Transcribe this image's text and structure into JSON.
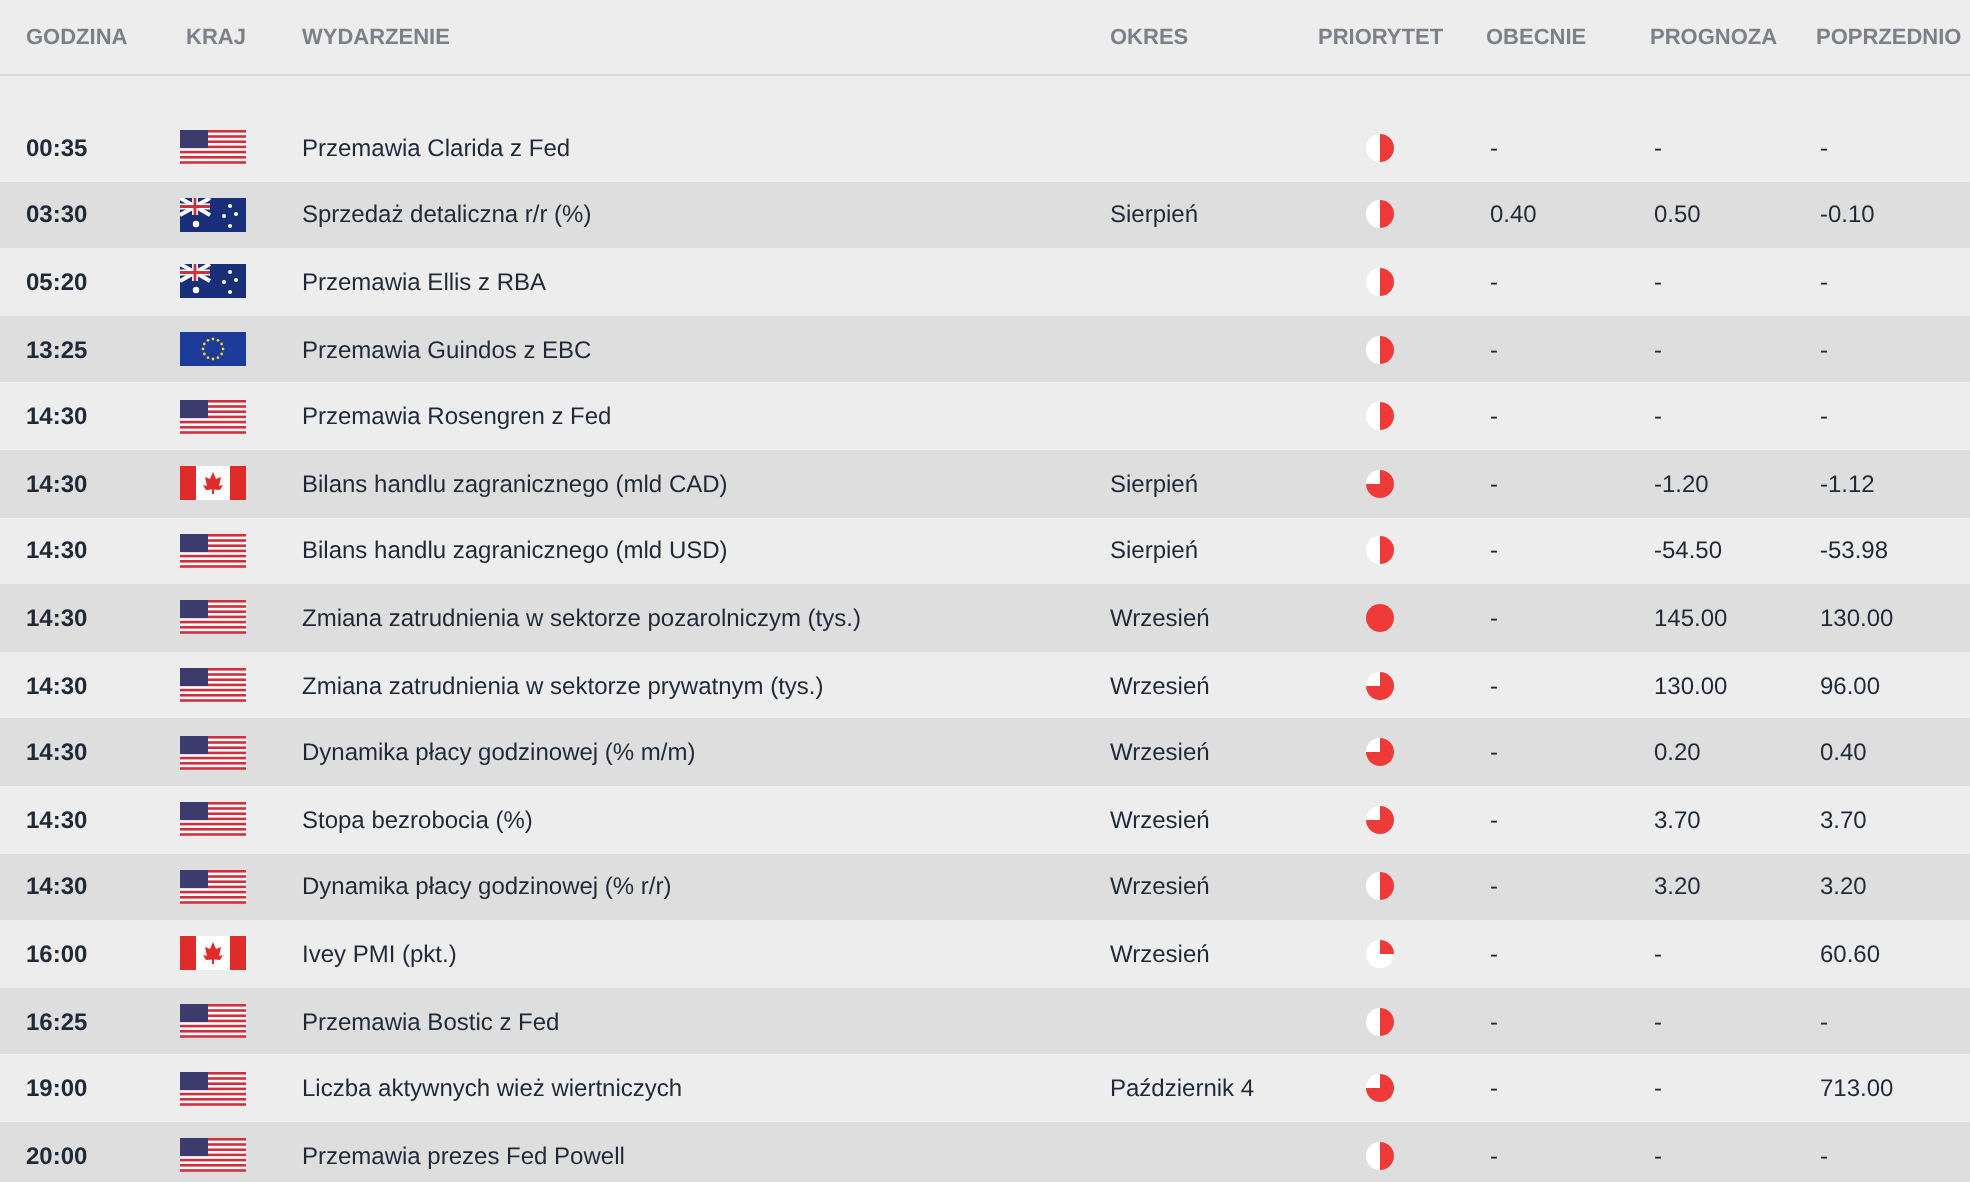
{
  "columns": [
    "GODZINA",
    "KRAJ",
    "WYDARZENIE",
    "OKRES",
    "PRIORYTET",
    "OBECNIE",
    "PROGNOZA",
    "POPRZEDNIO"
  ],
  "rows": [
    {
      "time": "00:35",
      "flag": {
        "kind": "us"
      },
      "event": "Przemawia Clarida z Fed",
      "priority": {
        "kind": "medium"
      },
      "actual": "-",
      "forecast": "-",
      "previous": "-"
    },
    {
      "time": "03:30",
      "flag": {
        "kind": "au"
      },
      "event": "Sprzedaż detaliczna r/r (%)",
      "period": "Sierpień",
      "priority": {
        "kind": "medium"
      },
      "actual": "0.40",
      "forecast": "0.50",
      "previous": "-0.10"
    },
    {
      "time": "05:20",
      "flag": {
        "kind": "au"
      },
      "event": "Przemawia Ellis z RBA",
      "priority": {
        "kind": "medium"
      },
      "actual": "-",
      "forecast": "-",
      "previous": "-"
    },
    {
      "time": "13:25",
      "flag": {
        "kind": "eu"
      },
      "event": "Przemawia Guindos z EBC",
      "priority": {
        "kind": "medium"
      },
      "actual": "-",
      "forecast": "-",
      "previous": "-"
    },
    {
      "time": "14:30",
      "flag": {
        "kind": "us"
      },
      "event": "Przemawia Rosengren z Fed",
      "priority": {
        "kind": "medium"
      },
      "actual": "-",
      "forecast": "-",
      "previous": "-"
    },
    {
      "time": "14:30",
      "flag": {
        "kind": "ca"
      },
      "event": "Bilans handlu zagranicznego (mld CAD)",
      "period": "Sierpień",
      "priority": {
        "kind": "high"
      },
      "actual": "-",
      "forecast": "-1.20",
      "previous": "-1.12"
    },
    {
      "time": "14:30",
      "flag": {
        "kind": "us"
      },
      "event": "Bilans handlu zagranicznego (mld USD)",
      "period": "Sierpień",
      "priority": {
        "kind": "medium"
      },
      "actual": "-",
      "forecast": "-54.50",
      "previous": "-53.98"
    },
    {
      "time": "14:30",
      "flag": {
        "kind": "us"
      },
      "event": "Zmiana zatrudnienia w sektorze pozarolniczym (tys.)",
      "period": "Wrzesień",
      "priority": {
        "kind": "top"
      },
      "actual": "-",
      "forecast": "145.00",
      "previous": "130.00"
    },
    {
      "time": "14:30",
      "flag": {
        "kind": "us"
      },
      "event": "Zmiana zatrudnienia w sektorze prywatnym (tys.)",
      "period": "Wrzesień",
      "priority": {
        "kind": "high"
      },
      "actual": "-",
      "forecast": "130.00",
      "previous": "96.00"
    },
    {
      "time": "14:30",
      "flag": {
        "kind": "us"
      },
      "event": "Dynamika płacy godzinowej (% m/m)",
      "period": "Wrzesień",
      "priority": {
        "kind": "high"
      },
      "actual": "-",
      "forecast": "0.20",
      "previous": "0.40"
    },
    {
      "time": "14:30",
      "flag": {
        "kind": "us"
      },
      "event": "Stopa bezrobocia (%)",
      "period": "Wrzesień",
      "priority": {
        "kind": "high"
      },
      "actual": "-",
      "forecast": "3.70",
      "previous": "3.70"
    },
    {
      "time": "14:30",
      "flag": {
        "kind": "us"
      },
      "event": "Dynamika płacy godzinowej (% r/r)",
      "period": "Wrzesień",
      "priority": {
        "kind": "medium"
      },
      "actual": "-",
      "forecast": "3.20",
      "previous": "3.20"
    },
    {
      "time": "16:00",
      "flag": {
        "kind": "ca"
      },
      "event": "Ivey PMI (pkt.)",
      "period": "Wrzesień",
      "priority": {
        "kind": "low"
      },
      "actual": "-",
      "forecast": "-",
      "previous": "60.60"
    },
    {
      "time": "16:25",
      "flag": {
        "kind": "us"
      },
      "event": "Przemawia Bostic z Fed",
      "priority": {
        "kind": "medium"
      },
      "actual": "-",
      "forecast": "-",
      "previous": "-"
    },
    {
      "time": "19:00",
      "flag": {
        "kind": "us"
      },
      "event": "Liczba aktywnych wież wiertniczych",
      "period": "Październik 4",
      "priority": {
        "kind": "high"
      },
      "actual": "-",
      "forecast": "-",
      "previous": "713.00"
    },
    {
      "time": "20:00",
      "flag": {
        "kind": "us"
      },
      "event": "Przemawia prezes Fed Powell",
      "priority": {
        "kind": "medium"
      },
      "actual": "-",
      "forecast": "-",
      "previous": "-"
    }
  ]
}
